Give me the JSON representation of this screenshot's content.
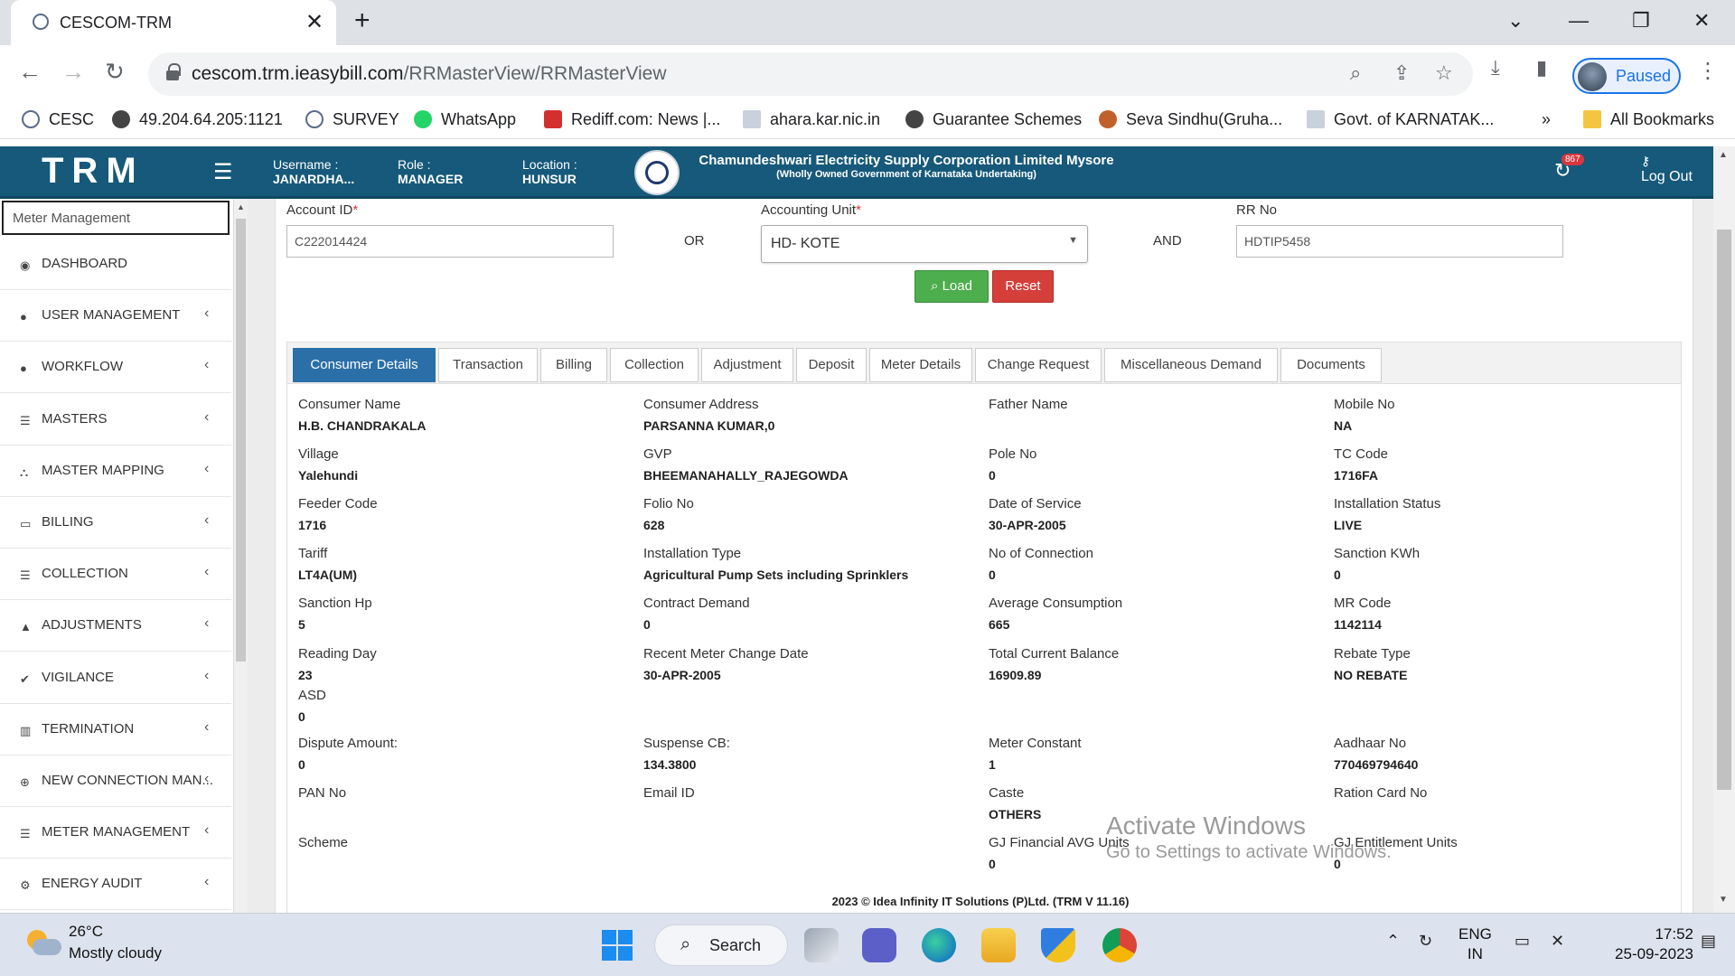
{
  "browser": {
    "tab_title": "CESCOM-TRM",
    "url_host": "cescom.trm.ieasybill.com",
    "url_path": "/RRMasterView/RRMasterView",
    "profile_label": "Paused",
    "bookmarks": [
      {
        "label": "CESC",
        "color": "#5a6b8a"
      },
      {
        "label": "49.204.64.205:1121",
        "color": "#444444"
      },
      {
        "label": "SURVEY",
        "color": "#5a6b8a"
      },
      {
        "label": "WhatsApp",
        "color": "#25d366"
      },
      {
        "label": "Rediff.com: News |...",
        "color": "#d32f2f"
      },
      {
        "label": "ahara.kar.nic.in",
        "color": "#9aa7b8"
      },
      {
        "label": "Guarantee Schemes",
        "color": "#444444"
      },
      {
        "label": "Seva Sindhu(Gruha...",
        "color": "#c0602a"
      },
      {
        "label": "Govt. of KARNATAK...",
        "color": "#9aa7b8"
      }
    ],
    "bookmarks_overflow": "»",
    "all_bookmarks": "All Bookmarks"
  },
  "header": {
    "brand": "TRM",
    "username_label": "Username :",
    "username_value": "JANARDHA...",
    "role_label": "Role :",
    "role_value": "MANAGER",
    "location_label": "Location :",
    "location_value": "HUNSUR",
    "org_line1": "Chamundeshwari Electricity Supply Corporation Limited Mysore",
    "org_line2": "(Wholly Owned Government of Karnataka Undertaking)",
    "notification_count": "867",
    "logout_label": "Log Out"
  },
  "sidebar": {
    "search_value": "Meter Management",
    "items": [
      {
        "label": "DASHBOARD",
        "icon": "dashboard-icon",
        "glyph": "◉",
        "chevron": false
      },
      {
        "label": "USER MANAGEMENT",
        "icon": "user-icon",
        "glyph": "●",
        "chevron": true
      },
      {
        "label": "WORKFLOW",
        "icon": "user-icon",
        "glyph": "●",
        "chevron": true
      },
      {
        "label": "MASTERS",
        "icon": "list-icon",
        "glyph": "☰",
        "chevron": true
      },
      {
        "label": "MASTER MAPPING",
        "icon": "sitemap-icon",
        "glyph": "⛬",
        "chevron": true
      },
      {
        "label": "BILLING",
        "icon": "monitor-icon",
        "glyph": "▭",
        "chevron": true
      },
      {
        "label": "COLLECTION",
        "icon": "list-icon",
        "glyph": "☰",
        "chevron": true
      },
      {
        "label": "ADJUSTMENTS",
        "icon": "adjust-icon",
        "glyph": "▲",
        "chevron": true
      },
      {
        "label": "VIGILANCE",
        "icon": "vk-icon",
        "glyph": "✔",
        "chevron": true
      },
      {
        "label": "TERMINATION",
        "icon": "trash-icon",
        "glyph": "▥",
        "chevron": true
      },
      {
        "label": "NEW CONNECTION MAN...",
        "icon": "plus-circle-icon",
        "glyph": "⊕",
        "chevron": true
      },
      {
        "label": "METER MANAGEMENT",
        "icon": "list-icon",
        "glyph": "☰",
        "chevron": true
      },
      {
        "label": "ENERGY AUDIT",
        "icon": "cogs-icon",
        "glyph": "⚙",
        "chevron": true
      }
    ],
    "chevron_glyph": "‹"
  },
  "search": {
    "account_id_label": "Account ID",
    "account_id_value": "C222014424",
    "or_label": "OR",
    "accounting_unit_label": "Accounting Unit",
    "accounting_unit_value": "HD- KOTE",
    "and_label": "AND",
    "rr_no_label": "RR No",
    "rr_no_value": "HDTIP5458",
    "required_mark": "*",
    "load_label": "Load",
    "reset_label": "Reset"
  },
  "tabs": [
    {
      "label": "Consumer Details",
      "active": true
    },
    {
      "label": "Transaction",
      "active": false
    },
    {
      "label": "Billing",
      "active": false
    },
    {
      "label": "Collection",
      "active": false
    },
    {
      "label": "Adjustment",
      "active": false
    },
    {
      "label": "Deposit",
      "active": false
    },
    {
      "label": "Meter Details",
      "active": false
    },
    {
      "label": "Change Request",
      "active": false
    },
    {
      "label": "Miscellaneous Demand",
      "active": false
    },
    {
      "label": "Documents",
      "active": false
    }
  ],
  "consumer_details": [
    [
      {
        "label": "Consumer Name",
        "value": "H.B. CHANDRAKALA"
      },
      {
        "label": "Consumer Address",
        "value": "PARSANNA KUMAR,0"
      },
      {
        "label": "Father Name",
        "value": ""
      },
      {
        "label": "Mobile No",
        "value": "NA"
      }
    ],
    [
      {
        "label": "Village",
        "value": "Yalehundi"
      },
      {
        "label": "GVP",
        "value": "BHEEMANAHALLY_RAJEGOWDA"
      },
      {
        "label": "Pole No",
        "value": "0"
      },
      {
        "label": "TC Code",
        "value": "1716FA"
      }
    ],
    [
      {
        "label": "Feeder Code",
        "value": "1716"
      },
      {
        "label": "Folio No",
        "value": "628"
      },
      {
        "label": "Date of Service",
        "value": "30-APR-2005"
      },
      {
        "label": "Installation Status",
        "value": "LIVE"
      }
    ],
    [
      {
        "label": "Tariff",
        "value": "LT4A(UM)"
      },
      {
        "label": "Installation Type",
        "value": "Agricultural Pump Sets including Sprinklers"
      },
      {
        "label": "No of Connection",
        "value": "0"
      },
      {
        "label": "Sanction KWh",
        "value": "0"
      }
    ],
    [
      {
        "label": "Sanction Hp",
        "value": "5"
      },
      {
        "label": "Contract Demand",
        "value": "0"
      },
      {
        "label": "Average Consumption",
        "value": "665"
      },
      {
        "label": "MR Code",
        "value": "1142114"
      }
    ],
    [
      {
        "label": "Reading Day",
        "value": "23"
      },
      {
        "label": "Recent Meter Change Date",
        "value": "30-APR-2005"
      },
      {
        "label": "Total Current Balance",
        "value": "16909.89"
      },
      {
        "label": "Rebate Type",
        "value": "NO REBATE"
      }
    ],
    [
      {
        "label": "ASD",
        "value": "0"
      }
    ],
    [
      {
        "label": "Dispute Amount:",
        "value": "0"
      },
      {
        "label": "Suspense CB:",
        "value": "134.3800"
      },
      {
        "label": "Meter Constant",
        "value": "1"
      },
      {
        "label": "Aadhaar No",
        "value": "770469794640"
      }
    ],
    [
      {
        "label": "PAN No",
        "value": ""
      },
      {
        "label": "Email ID",
        "value": ""
      },
      {
        "label": "Caste",
        "value": "OTHERS"
      },
      {
        "label": "Ration Card No",
        "value": ""
      }
    ],
    [
      {
        "label": "Scheme",
        "value": ""
      },
      {
        "label": "",
        "value": ""
      },
      {
        "label": "GJ Financial AVG Units",
        "value": "0"
      },
      {
        "label": "GJ Entitlement Units",
        "value": "0"
      }
    ]
  ],
  "footer": "2023 © Idea Infinity IT Solutions (P)Ltd. (TRM V 11.16)",
  "watermark": {
    "line1": "Activate Windows",
    "line2": "Go to Settings to activate Windows."
  },
  "taskbar": {
    "temperature": "26°C",
    "condition": "Mostly cloudy",
    "search_label": "Search",
    "lang_line1": "ENG",
    "lang_line2": "IN",
    "time": "17:52",
    "date": "25-09-2023"
  },
  "colors": {
    "header_bg": "#16597a",
    "active_tab": "#2a6fa8",
    "load_button": "#4cae4c",
    "reset_button": "#d43f3a"
  }
}
